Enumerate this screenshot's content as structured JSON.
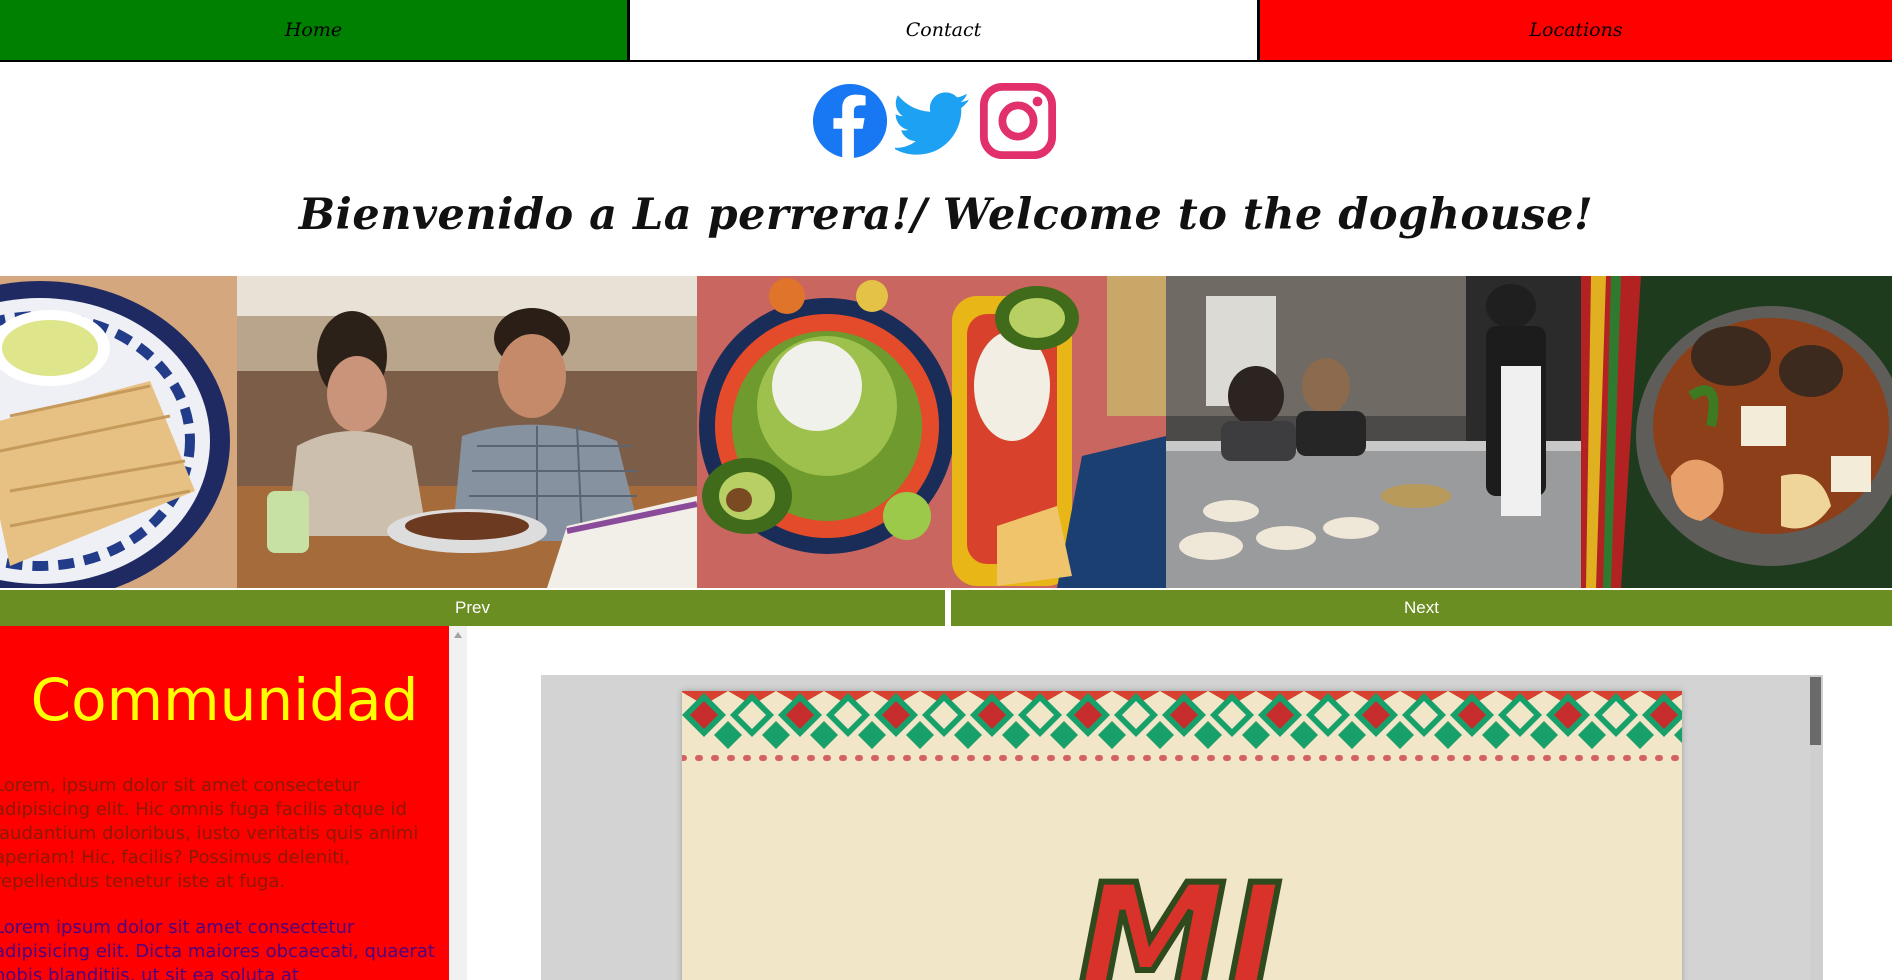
{
  "nav": {
    "home_label": "Home",
    "contact_label": "Contact",
    "locations_label": "Locations",
    "colors": {
      "home": "#008000",
      "contact": "#ffffff",
      "locations": "#ff0000"
    }
  },
  "social": {
    "icons": [
      "facebook-icon",
      "twitter-icon",
      "instagram-icon"
    ],
    "colors": {
      "facebook": "#1877f2",
      "twitter": "#1da1f2",
      "instagram": "#e1306c"
    }
  },
  "welcome_text": "Bienvenido a La perrera!/ Welcome to the doghouse!",
  "carousel": {
    "images": [
      "tamales-plate",
      "couple-dining",
      "mexican-dishes-table",
      "restaurant-grill-kitchen",
      "molcajete-seafood"
    ],
    "prev_label": "Prev",
    "next_label": "Next",
    "control_color": "#6b8e23"
  },
  "community": {
    "heading": "Communidad",
    "paragraph_1": "Lorem, ipsum dolor sit amet consectetur adipisicing elit. Hic omnis fuga facilis atque id laudantium doloribus, iusto veritatis quis animi aperiam! Hic, facilis? Possimus deleniti, repellendus tenetur iste at fuga.",
    "paragraph_2": "Lorem ipsum dolor sit amet consectetur adipisicing elit. Dicta maiores obcaecati, quaerat nobis blanditiis, ut sit ea soluta at",
    "heading_color": "#ffff00",
    "background_color": "#ff0000"
  },
  "menu_viewer": {
    "title_letters": "MI"
  }
}
